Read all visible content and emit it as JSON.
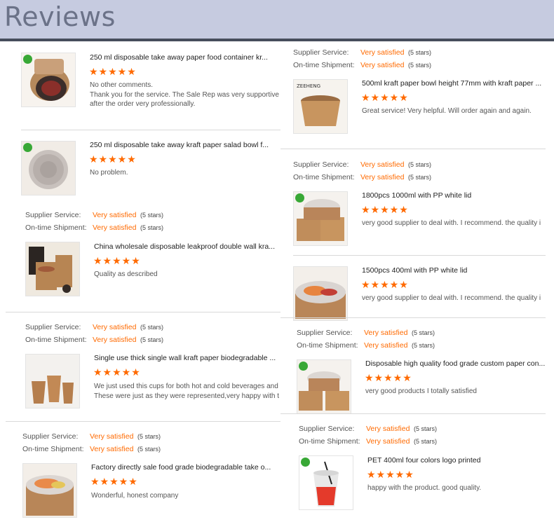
{
  "header": {
    "title": "Reviews"
  },
  "labels": {
    "supplier_service": "Supplier Service:",
    "ontime_shipment": "On-time Shipment:",
    "very_satisfied": "Very satisfied",
    "five_stars": "(5 stars)",
    "star_glyphs": "★★★★★"
  },
  "reviews": [
    {
      "title": "250 ml disposable take away paper food container kr...",
      "comment_lines": [
        "No other comments.",
        "Thank you for the service. The Sale Rep was very supportive",
        "after the order very professionally."
      ]
    },
    {
      "title": "250 ml disposable take away kraft paper salad bowl f...",
      "comment_lines": [
        "No problem."
      ]
    },
    {
      "title": "China wholesale disposable leakproof double wall kra...",
      "comment_lines": [
        "Quality as described"
      ]
    },
    {
      "title": "Single use thick single wall kraft paper biodegradable ...",
      "comment_lines": [
        "We just used this cups for both hot and cold beverages and",
        "These were just as they were represented,very happy with t"
      ]
    },
    {
      "title": "Factory directly sale food grade biodegradable take o...",
      "comment_lines": [
        "Wonderful, honest company"
      ]
    },
    {
      "title": "500ml kraft paper bowl height 77mm with kraft paper ...",
      "comment_lines": [
        "Great service! Very helpful. Will order again and again."
      ]
    },
    {
      "title": "1800pcs 1000ml with PP white lid",
      "comment_lines": [
        "very good supplier to deal with. I recommend. the quality i"
      ]
    },
    {
      "title": "1500pcs 400ml with PP white lid",
      "comment_lines": [
        "very good supplier to deal with. I recommend. the quality i"
      ]
    },
    {
      "title": "Disposable high quality food grade custom paper con...",
      "comment_lines": [
        "very good products I totally satisfied"
      ]
    },
    {
      "title": "PET 400ml four colors logo printed",
      "comment_lines": [
        "happy with the product. good quality."
      ]
    }
  ],
  "thumb_text": {
    "zeeheng": "ZEEHENG"
  },
  "colors": {
    "accent": "#ff6a00",
    "header_bg": "#c6cbe0",
    "header_text": "#6b7288",
    "rule": "#474d5c"
  }
}
